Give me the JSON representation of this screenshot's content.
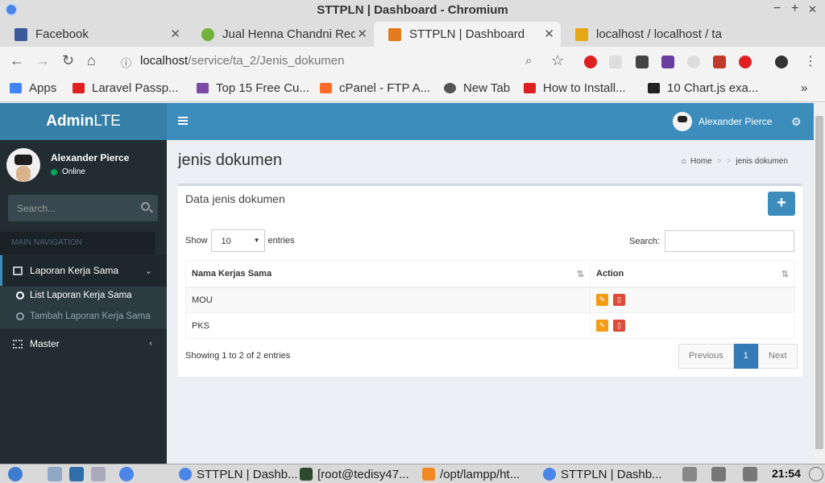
{
  "window": {
    "title": "STTPLN | Dashboard - Chromium",
    "min": "−",
    "max": "+",
    "close": "✕"
  },
  "tabs": [
    {
      "label": "Facebook",
      "color": "#3b5998"
    },
    {
      "label": "Jual Henna Chandni Red",
      "color": "#6fb33a"
    },
    {
      "label": "STTPLN | Dashboard",
      "color": "#e37a1f"
    },
    {
      "label": "localhost / localhost / ta",
      "color": "#e6a817"
    }
  ],
  "omnibox": {
    "host": "localhost",
    "path": "/service/ta_2/Jenis_dokumen"
  },
  "bookmarks": [
    {
      "label": "Apps",
      "color": "#4285f4"
    },
    {
      "label": "Laravel Passp...",
      "color": "#e02020"
    },
    {
      "label": "Top 15 Free Cu...",
      "color": "#7b4aa8"
    },
    {
      "label": "cPanel - FTP A...",
      "color": "#ff6c2c"
    },
    {
      "label": "New Tab",
      "color": "#555555"
    },
    {
      "label": "How to Install...",
      "color": "#e02020"
    },
    {
      "label": "10 Chart.js exa...",
      "color": "#222222"
    }
  ],
  "bookmarks_more": "»",
  "app": {
    "logo_bold": "Admin",
    "logo_light": "LTE",
    "nav_user": "Alexander Pierce"
  },
  "sidebar": {
    "user": "Alexander Pierce",
    "status": "Online",
    "search_placeholder": "Search...",
    "header": "MAIN NAVIGATION",
    "laporan": "Laporan Kerja Sama",
    "sub_list": "List Laporan Kerja Sama",
    "sub_tambah": "Tambah Laporan Kerja Sama",
    "master": "Master"
  },
  "content": {
    "title": "jenis dokumen",
    "bc_home": "Home",
    "bc_current": "jenis dokumen"
  },
  "box": {
    "title": "Data jenis dokumen",
    "add": "+",
    "show": "Show",
    "entries": "entries",
    "length": "10",
    "search": "Search:",
    "columns": [
      "Nama Kerjas Sama",
      "Action"
    ],
    "rows": [
      "MOU",
      "PKS"
    ],
    "info": "Showing 1 to 2 of 2 entries",
    "pager": {
      "prev": "Previous",
      "page": "1",
      "next": "Next"
    }
  },
  "taskbar": {
    "items": [
      "STTPLN | Dashb...",
      "[root@tedisy47...",
      "/opt/lampp/ht...",
      "STTPLN | Dashb..."
    ],
    "clock": "21:54"
  }
}
